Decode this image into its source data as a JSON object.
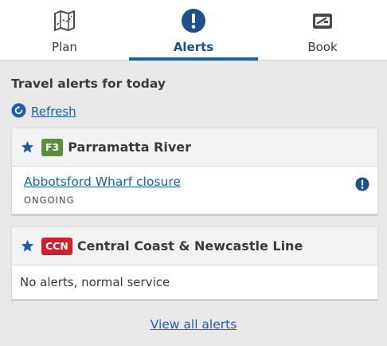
{
  "tabs": [
    {
      "label": "Plan",
      "icon": "map-icon",
      "active": false
    },
    {
      "label": "Alerts",
      "icon": "alert-icon",
      "active": true
    },
    {
      "label": "Book",
      "icon": "ticket-icon",
      "active": false
    }
  ],
  "colors": {
    "accent": "#1f5ea8",
    "f3_badge": "#5b8f3a",
    "ccn_badge": "#d0202e"
  },
  "section_title": "Travel alerts for today",
  "refresh_label": "Refresh",
  "lines": [
    {
      "code": "F3",
      "name": "Parramatta River",
      "favourite_icon": "star-icon",
      "alerts": [
        {
          "title": "Abbotsford Wharf closure",
          "status": "ONGOING",
          "icon": "info-alert-icon"
        }
      ]
    },
    {
      "code": "CCN",
      "name": "Central Coast & Newcastle Line",
      "favourite_icon": "star-icon",
      "message": "No alerts, normal service"
    }
  ],
  "view_all_label": "View all alerts"
}
